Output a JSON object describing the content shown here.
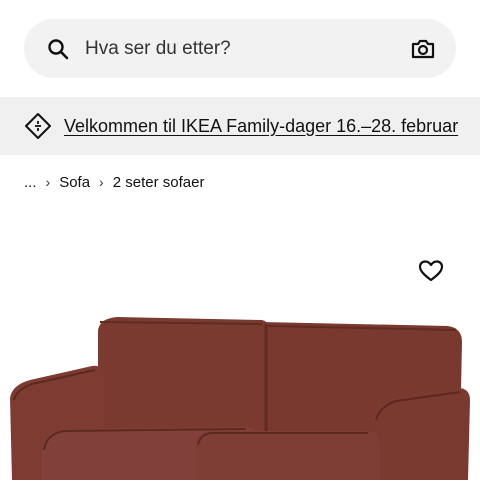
{
  "search": {
    "placeholder": "Hva ser du etter?",
    "icon": "search-icon",
    "camera_icon": "camera-icon"
  },
  "promo": {
    "icon": "tag-icon",
    "text": "Velkommen til IKEA Family-dager 16.–28. februar"
  },
  "breadcrumb": {
    "items": [
      "...",
      "Sofa",
      "2 seter sofaer"
    ],
    "separator": "›"
  },
  "product": {
    "favorite_icon": "heart-icon",
    "image_color": "#7a3a30"
  }
}
